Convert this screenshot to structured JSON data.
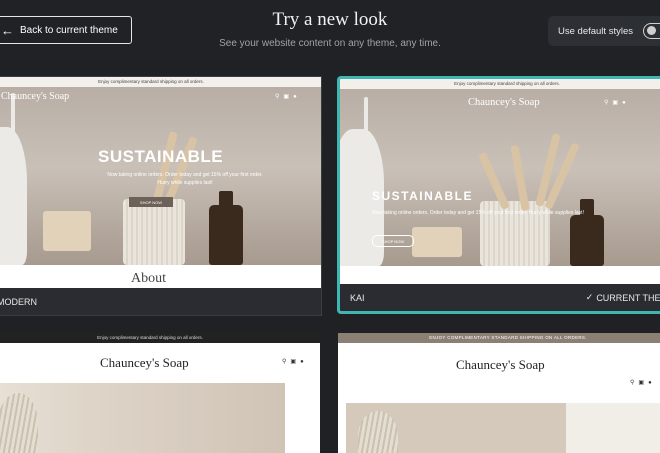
{
  "header": {
    "back_label": "Back to current theme",
    "title": "Try a new look",
    "subtitle": "See your website content on any theme, any time.",
    "toggle_label": "Use default styles",
    "toggle_on": false
  },
  "themes": [
    {
      "name": "MODERN",
      "announcement": "Enjoy complimentary standard shipping on all orders.",
      "brand": "Chauncey's Soap",
      "headline": "SUSTAINABLE",
      "hero_text": "Now taking online orders. Order today and get 15% off your first order. Hurry while supplies last!",
      "button": "SHOP NOW",
      "section": "About",
      "current": false
    },
    {
      "name": "KAI",
      "announcement": "Enjoy complimentary standard shipping on all orders.",
      "brand": "Chauncey's Soap",
      "headline": "SUSTAINABLE",
      "hero_text": "Now taking online orders. Order today and get 15% off your first order. Hurry while supplies last!",
      "button": "SHOP NOW",
      "current": true,
      "current_label": "CURRENT THEME"
    },
    {
      "announcement": "Enjoy complimentary standard shipping on all orders.",
      "brand": "Chauncey's Soap"
    },
    {
      "announcement": "ENJOY COMPLIMENTARY STANDARD SHIPPING ON ALL ORDERS.",
      "brand": "Chauncey's Soap"
    }
  ],
  "colors": {
    "background": "#1f2125",
    "selected_border": "#3fb6b2"
  }
}
